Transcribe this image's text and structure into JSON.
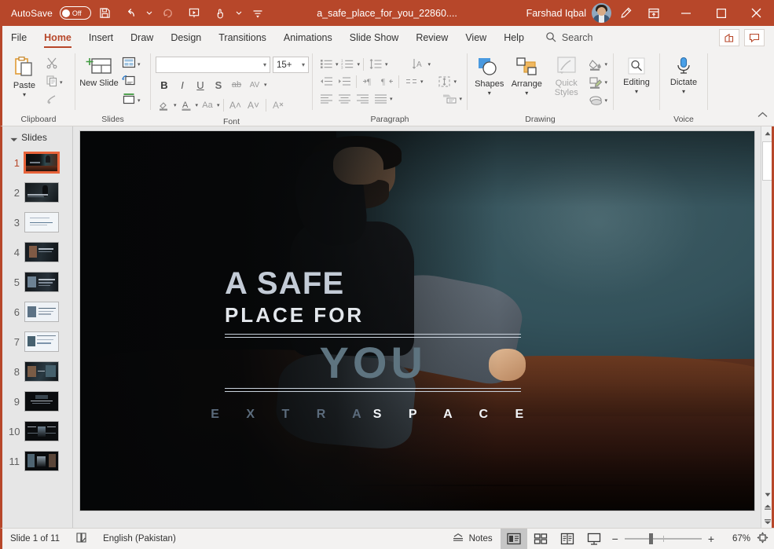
{
  "titlebar": {
    "autosave_label": "AutoSave",
    "autosave_state": "Off",
    "filename": "a_safe_place_for_you_22860....",
    "username": "Farshad Iqbal",
    "qat": [
      "save-icon",
      "undo-icon",
      "redo-icon",
      "start-presentation-icon",
      "touch-mode-icon",
      "customize-qat-icon"
    ],
    "window_buttons": [
      "minimize",
      "maximize",
      "close"
    ],
    "accent_color": "#b7472a"
  },
  "tabs": [
    {
      "label": "File",
      "active": false
    },
    {
      "label": "Home",
      "active": true
    },
    {
      "label": "Insert",
      "active": false
    },
    {
      "label": "Draw",
      "active": false
    },
    {
      "label": "Design",
      "active": false
    },
    {
      "label": "Transitions",
      "active": false
    },
    {
      "label": "Animations",
      "active": false
    },
    {
      "label": "Slide Show",
      "active": false
    },
    {
      "label": "Review",
      "active": false
    },
    {
      "label": "View",
      "active": false
    },
    {
      "label": "Help",
      "active": false
    }
  ],
  "search": {
    "label": "Search",
    "icon": "search-icon"
  },
  "tabrow_right": {
    "share_icon": "share-icon",
    "comments_icon": "comments-icon"
  },
  "ribbon": {
    "clipboard": {
      "label": "Clipboard",
      "paste_label": "Paste",
      "cut_icon": "scissors-icon",
      "copy_icon": "copy-icon",
      "format_painter_icon": "format-painter-icon"
    },
    "slides": {
      "label": "Slides",
      "new_slide_label": "New Slide",
      "layout_icon": "layout-icon",
      "reset_icon": "reset-icon",
      "section_icon": "section-icon"
    },
    "font": {
      "label": "Font",
      "font_name_value": "",
      "font_name_placeholder": "",
      "font_size_value": "15+",
      "bold": "B",
      "italic": "I",
      "underline": "U",
      "shadow": "S",
      "strikethrough": "ab",
      "char_spacing": "AV",
      "text_highlight_icon": "text-highlight-icon",
      "font_color_icon": "font-color-icon",
      "change_case": "Aa",
      "increase_size": "A",
      "decrease_size": "A",
      "clear_formatting_icon": "clear-formatting-icon"
    },
    "paragraph": {
      "label": "Paragraph",
      "bullets_icon": "bullets-icon",
      "numbering_icon": "numbering-icon",
      "line_spacing_icon": "line-spacing-icon",
      "text_direction_icon": "text-direction-icon",
      "decrease_indent_icon": "decrease-indent-icon",
      "increase_indent_icon": "increase-indent-icon",
      "rtl_icon": "rtl-icon",
      "ltr_icon": "ltr-icon",
      "columns_icon": "columns-icon",
      "align_text_icon": "align-text-icon",
      "align_left_icon": "align-left-icon",
      "align_center_icon": "align-center-icon",
      "align_right_icon": "align-right-icon",
      "justify_icon": "justify-icon",
      "smartart_icon": "smartart-icon"
    },
    "drawing": {
      "label": "Drawing",
      "shapes_label": "Shapes",
      "arrange_label": "Arrange",
      "quick_styles_label": "Quick Styles",
      "shape_fill_icon": "shape-fill-icon",
      "shape_outline_icon": "shape-outline-icon",
      "shape_effects_icon": "shape-effects-icon"
    },
    "editing": {
      "label": "Editing",
      "editing_label": "Editing",
      "icon": "magnifier-icon"
    },
    "voice": {
      "label": "Voice",
      "dictate_label": "Dictate",
      "icon": "microphone-icon"
    },
    "collapse_icon": "collapse-ribbon-icon"
  },
  "thumbpane": {
    "header": "Slides",
    "caret": "expand-caret",
    "slides": [
      {
        "number": "1",
        "selected": true
      },
      {
        "number": "2",
        "selected": false
      },
      {
        "number": "3",
        "selected": false
      },
      {
        "number": "4",
        "selected": false
      },
      {
        "number": "5",
        "selected": false
      },
      {
        "number": "6",
        "selected": false
      },
      {
        "number": "7",
        "selected": false
      },
      {
        "number": "8",
        "selected": false
      },
      {
        "number": "9",
        "selected": false
      },
      {
        "number": "10",
        "selected": false
      },
      {
        "number": "11",
        "selected": false
      }
    ]
  },
  "slide": {
    "title_line1": "A SAFE",
    "title_line2": "PLACE FOR",
    "title_line3": "YOU",
    "subtitle_part1": "E X T R A",
    "subtitle_part2": "S P A C E",
    "colors": {
      "title_light": "#c3cbd6",
      "title_white": "#e3e7ec",
      "accent_slate": "#5e7480",
      "rule": "#c9d2dc"
    },
    "photo_description": "man-on-leather-sofa-photo"
  },
  "status": {
    "slide_counter": "Slide 1 of 11",
    "accessibility_icon": "accessibility-checker-icon",
    "language": "English (Pakistan)",
    "notes_label": "Notes",
    "notes_icon": "notes-icon",
    "views": [
      {
        "name": "normal-view",
        "active": true
      },
      {
        "name": "slide-sorter-view",
        "active": false
      },
      {
        "name": "reading-view",
        "active": false
      },
      {
        "name": "slide-show-view",
        "active": false
      }
    ],
    "zoom_out": "−",
    "zoom_in": "+",
    "zoom_level": "67%",
    "fit_icon": "fit-to-window-icon"
  }
}
